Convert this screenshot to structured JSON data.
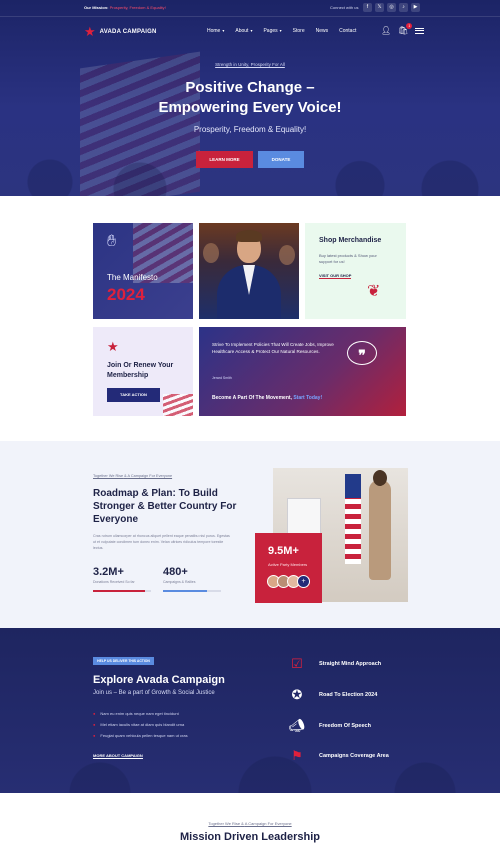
{
  "topbar": {
    "mission_label": "Our Mission:",
    "mission_text": "Prosperity, Freedom & Equality!",
    "contact": "Connect with us",
    "socials": [
      "f",
      "𝕏",
      "◎",
      "♪",
      "▶"
    ]
  },
  "nav": {
    "logo": "AVADA CAMPAIGN",
    "items": [
      {
        "label": "Home",
        "dropdown": true
      },
      {
        "label": "About",
        "dropdown": true
      },
      {
        "label": "Pages",
        "dropdown": true
      },
      {
        "label": "Store",
        "dropdown": false
      },
      {
        "label": "News",
        "dropdown": false
      },
      {
        "label": "Contact",
        "dropdown": false
      }
    ],
    "cart_count": "1"
  },
  "hero": {
    "tagline": "Strength in Unity, Prosperity For All",
    "title_line1": "Positive Change –",
    "title_line2": "Empowering Every Voice!",
    "subtitle": "Prosperity, Freedom & Equality!",
    "learn_more": "LEARN MORE",
    "donate": "DONATE"
  },
  "cards": {
    "manifesto_label": "The Manifesto",
    "manifesto_year": "2024",
    "shop_title": "Shop Merchandise",
    "shop_text": "Buy latest products & Show your support for us!",
    "shop_link": "VISIT OUR SHOP",
    "join_title": "Join Or Renew Your Membership",
    "join_button": "TAKE ACTION",
    "movement_text": "Strive To Implement Policies That Will Create Jobs, Improve Healthcare Access & Protect Our Natural Resources.",
    "movement_author": "Jerard Smith",
    "movement_cta": "Become A Part Of The Movement,",
    "movement_cta_link": "Start Today!"
  },
  "roadmap": {
    "kicker_a": "Together We Rise",
    "kicker_b": "A Campaign For Everyone",
    "title": "Roadmap & Plan: To Build Stronger & Better Country For Everyone",
    "body": "Cras rutrum ullamcorper at rhoncus aliquet pellent eaque penatibu nisl purus. Egestas ut et vulputate condimen tum donec enim. Velan ultrices ridiculus tempore torestie lectus.",
    "stats": [
      {
        "number": "3.2M+",
        "label": "Donations Received So far",
        "progress": 0.9,
        "color": "#c8223c"
      },
      {
        "number": "480+",
        "label": "Campaigns & Rallies",
        "progress": 0.75,
        "color": "#5a8be0"
      }
    ],
    "members_number": "9.5M+",
    "members_label": "Active Party Members",
    "members_plus": "+"
  },
  "explore": {
    "pill": "HELP US DELIVER THIS ACTION",
    "title": "Explore Avada Campaign",
    "subtitle": "Join us – Be a part of Growth & Social Justice",
    "bullets": [
      "Nam eu enim quis neque nam eget tincidunt",
      "Mel etiam iaculis vitae at diam quis blandit urna",
      "Feugiat quam vehicula pellen tesque nam ut cras"
    ],
    "more": "MORE ABOUT CAMPAIGN",
    "features": [
      {
        "label": "Straight Mind Approach",
        "icon": "checkbox-icon"
      },
      {
        "label": "Road To Election 2024",
        "icon": "vote-badge-icon"
      },
      {
        "label": "Freedom Of Speech",
        "icon": "megaphone-icon"
      },
      {
        "label": "Campaigns Coverage Area",
        "icon": "flag-icon"
      }
    ]
  },
  "mission": {
    "kicker_a": "Together We Rise",
    "kicker_b": "A Campaign For Everyone",
    "title": "Mission Driven Leadership"
  },
  "colors": {
    "navy": "#1e2560",
    "red": "#c8223c",
    "blue": "#5a8be0"
  }
}
